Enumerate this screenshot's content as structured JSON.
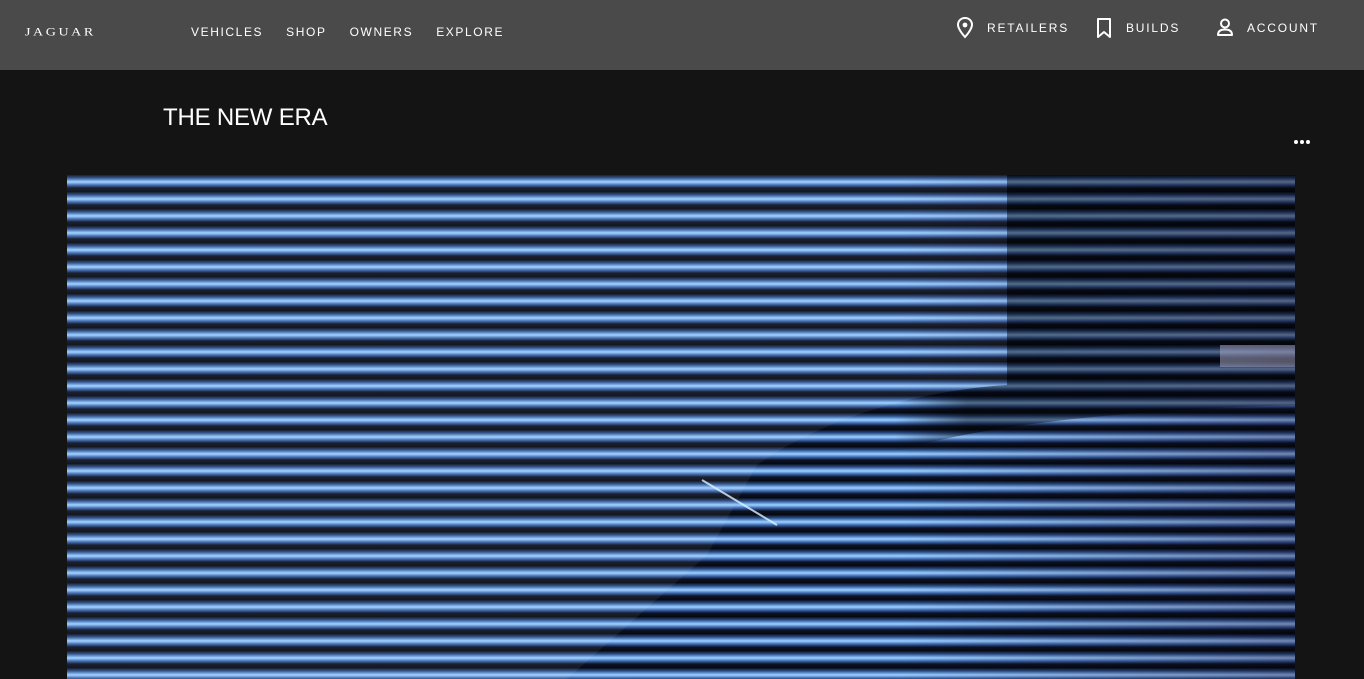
{
  "header": {
    "logo_text": "JAGUAR",
    "nav": [
      {
        "label": "VEHICLES"
      },
      {
        "label": "SHOP"
      },
      {
        "label": "OWNERS"
      },
      {
        "label": "EXPLORE"
      }
    ],
    "utilities": {
      "retailers": {
        "label": "RETAILERS",
        "icon": "location-pin-icon"
      },
      "builds": {
        "label": "BUILDS",
        "icon": "bookmark-icon"
      },
      "account": {
        "label": "ACCOUNT",
        "icon": "user-icon"
      }
    }
  },
  "main": {
    "title": "THE NEW ERA",
    "more_icon": "more-horizontal-icon"
  },
  "colors": {
    "header_bg": "#4a4a4a",
    "page_bg": "#141414",
    "text": "#ffffff",
    "hero_accent": "#7fb5ef"
  }
}
